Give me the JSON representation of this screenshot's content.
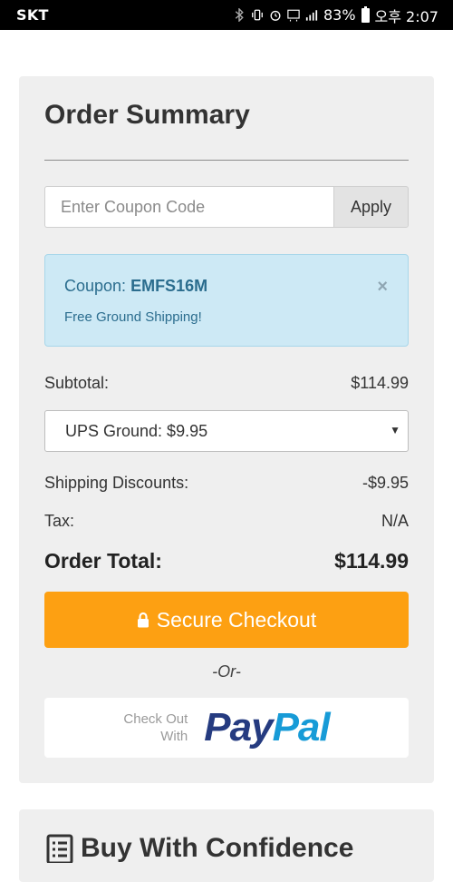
{
  "status_bar": {
    "carrier": "SKT",
    "battery": "83%",
    "time": "오후 2:07"
  },
  "order_summary": {
    "title": "Order Summary",
    "coupon_input": {
      "placeholder": "Enter Coupon Code",
      "value": ""
    },
    "apply_label": "Apply",
    "coupon_alert": {
      "prefix": "Coupon: ",
      "code": "EMFS16M",
      "message": "Free Ground Shipping!",
      "close_symbol": "×"
    },
    "subtotal": {
      "label": "Subtotal:",
      "value": "$114.99"
    },
    "shipping_select": {
      "selected": "UPS Ground: $9.95",
      "arrow": "▼"
    },
    "shipping_discounts": {
      "label": "Shipping Discounts:",
      "value": "-$9.95"
    },
    "tax": {
      "label": "Tax:",
      "value": "N/A"
    },
    "order_total": {
      "label": "Order Total:",
      "value": "$114.99"
    },
    "checkout_label": "Secure Checkout",
    "or_text": "-Or-",
    "paypal": {
      "small_line1": "Check Out",
      "small_line2": "With",
      "logo_pay": "Pay",
      "logo_pal": "Pal"
    }
  },
  "confidence": {
    "title": "Buy With Confidence"
  },
  "colors": {
    "accent": "#fda012",
    "alert_bg": "#cde9f5",
    "alert_text": "#2b6d8e",
    "paypal_dark": "#253b80",
    "paypal_light": "#179bd7"
  }
}
